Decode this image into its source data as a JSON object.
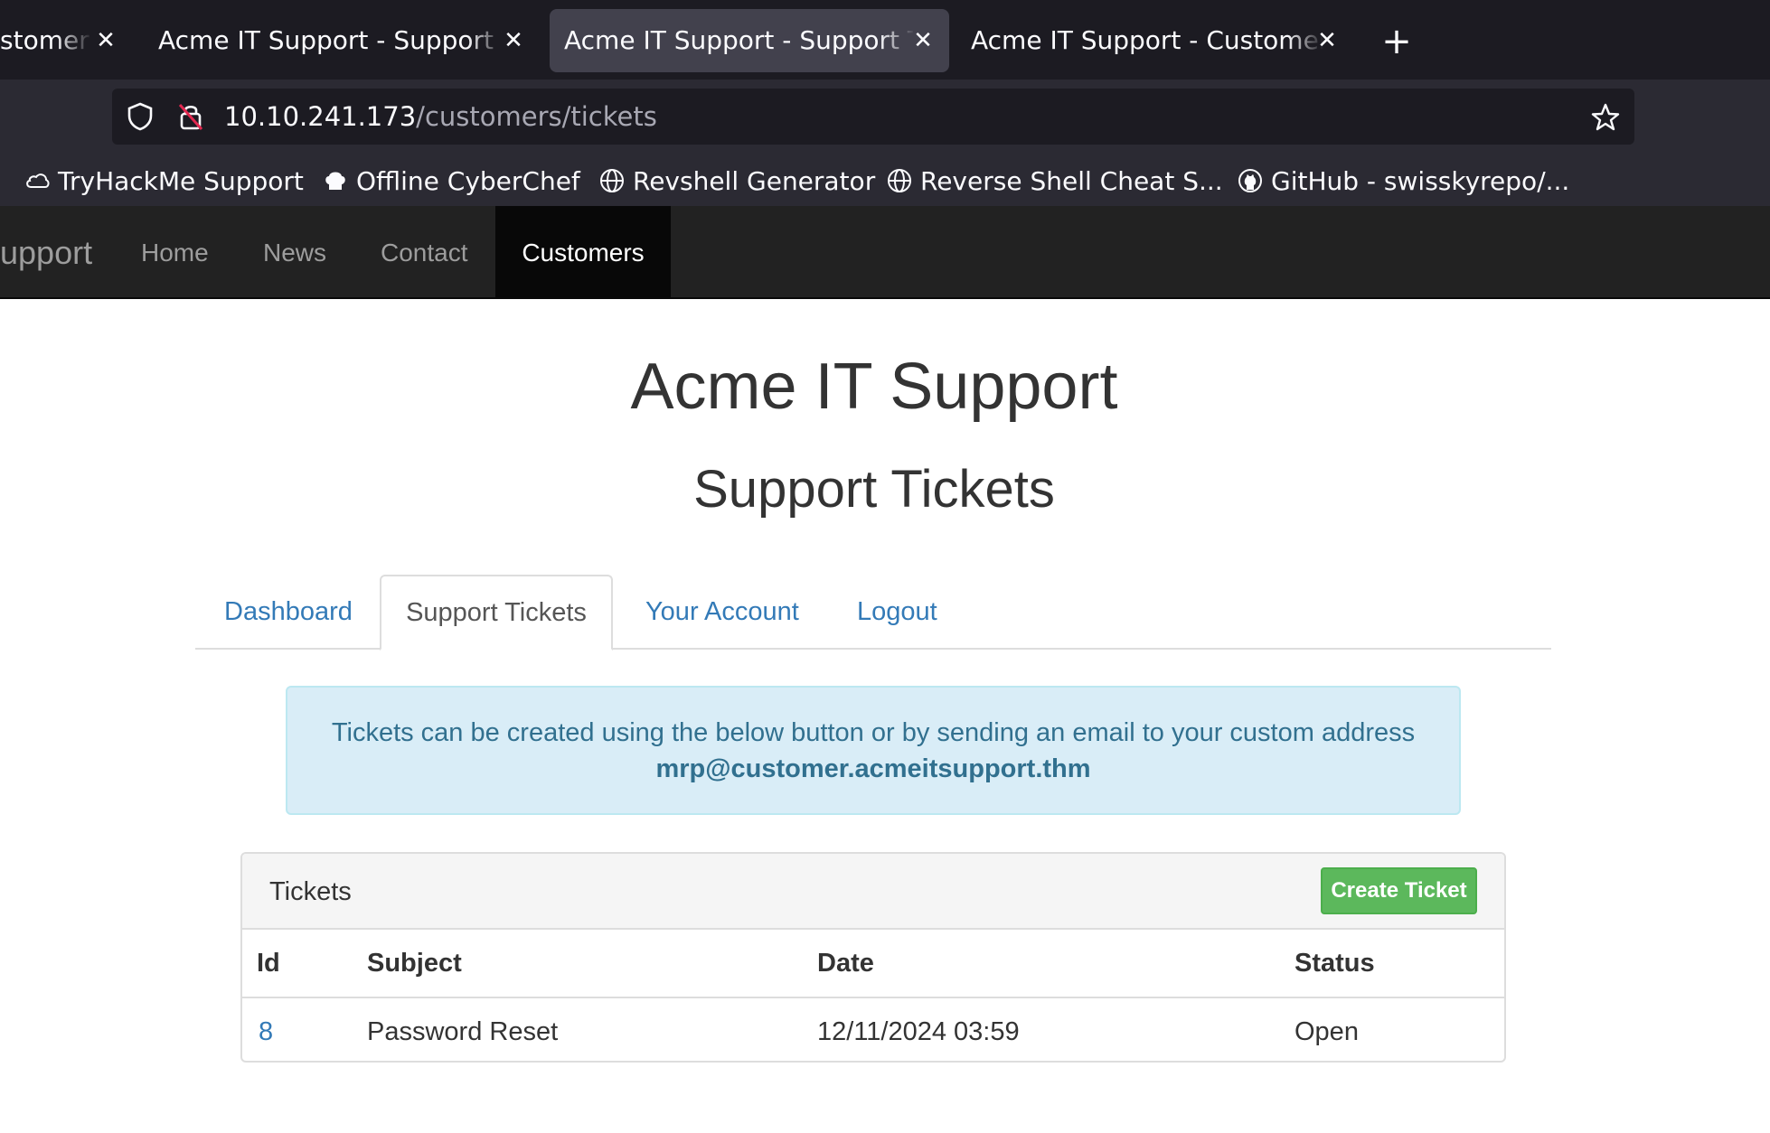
{
  "browser": {
    "tabs": [
      {
        "title": "stomer",
        "active": false
      },
      {
        "title": "Acme IT Support - Support Ti",
        "active": false
      },
      {
        "title": "Acme IT Support - Support Ti",
        "active": true
      },
      {
        "title": "Acme IT Support - Customer",
        "active": false
      }
    ],
    "new_tab_label": "+",
    "url_host": "10.10.241.173",
    "url_path": "/customers/tickets",
    "bookmarks": [
      {
        "label": "TryHackMe Support",
        "icon": "cloud-icon"
      },
      {
        "label": "Offline CyberChef",
        "icon": "chef-hat-icon"
      },
      {
        "label": "Revshell Generator",
        "icon": "globe-icon"
      },
      {
        "label": "Reverse Shell Cheat S...",
        "icon": "globe-icon"
      },
      {
        "label": "GitHub - swisskyrepo/...",
        "icon": "github-icon"
      }
    ]
  },
  "site_nav": {
    "brand": "upport",
    "links": [
      "Home",
      "News",
      "Contact"
    ],
    "active_link": "Customers"
  },
  "page": {
    "title": "Acme IT Support",
    "subtitle": "Support Tickets"
  },
  "tabs": {
    "dashboard": "Dashboard",
    "support_tickets": "Support Tickets",
    "your_account": "Your Account",
    "logout": "Logout"
  },
  "alert": {
    "line1": "Tickets can be created using the below button or by sending an email to your custom address",
    "email": "mrp@customer.acmeitsupport.thm"
  },
  "tickets": {
    "heading": "Tickets",
    "create_button": "Create Ticket",
    "columns": [
      "Id",
      "Subject",
      "Date",
      "Status"
    ],
    "rows": [
      {
        "id": "8",
        "subject": "Password Reset",
        "date": "12/11/2024 03:59",
        "status": "Open"
      }
    ]
  },
  "colors": {
    "link": "#337ab7",
    "success": "#5cb85c",
    "info_bg": "#d9edf7",
    "navbar": "#222222"
  }
}
